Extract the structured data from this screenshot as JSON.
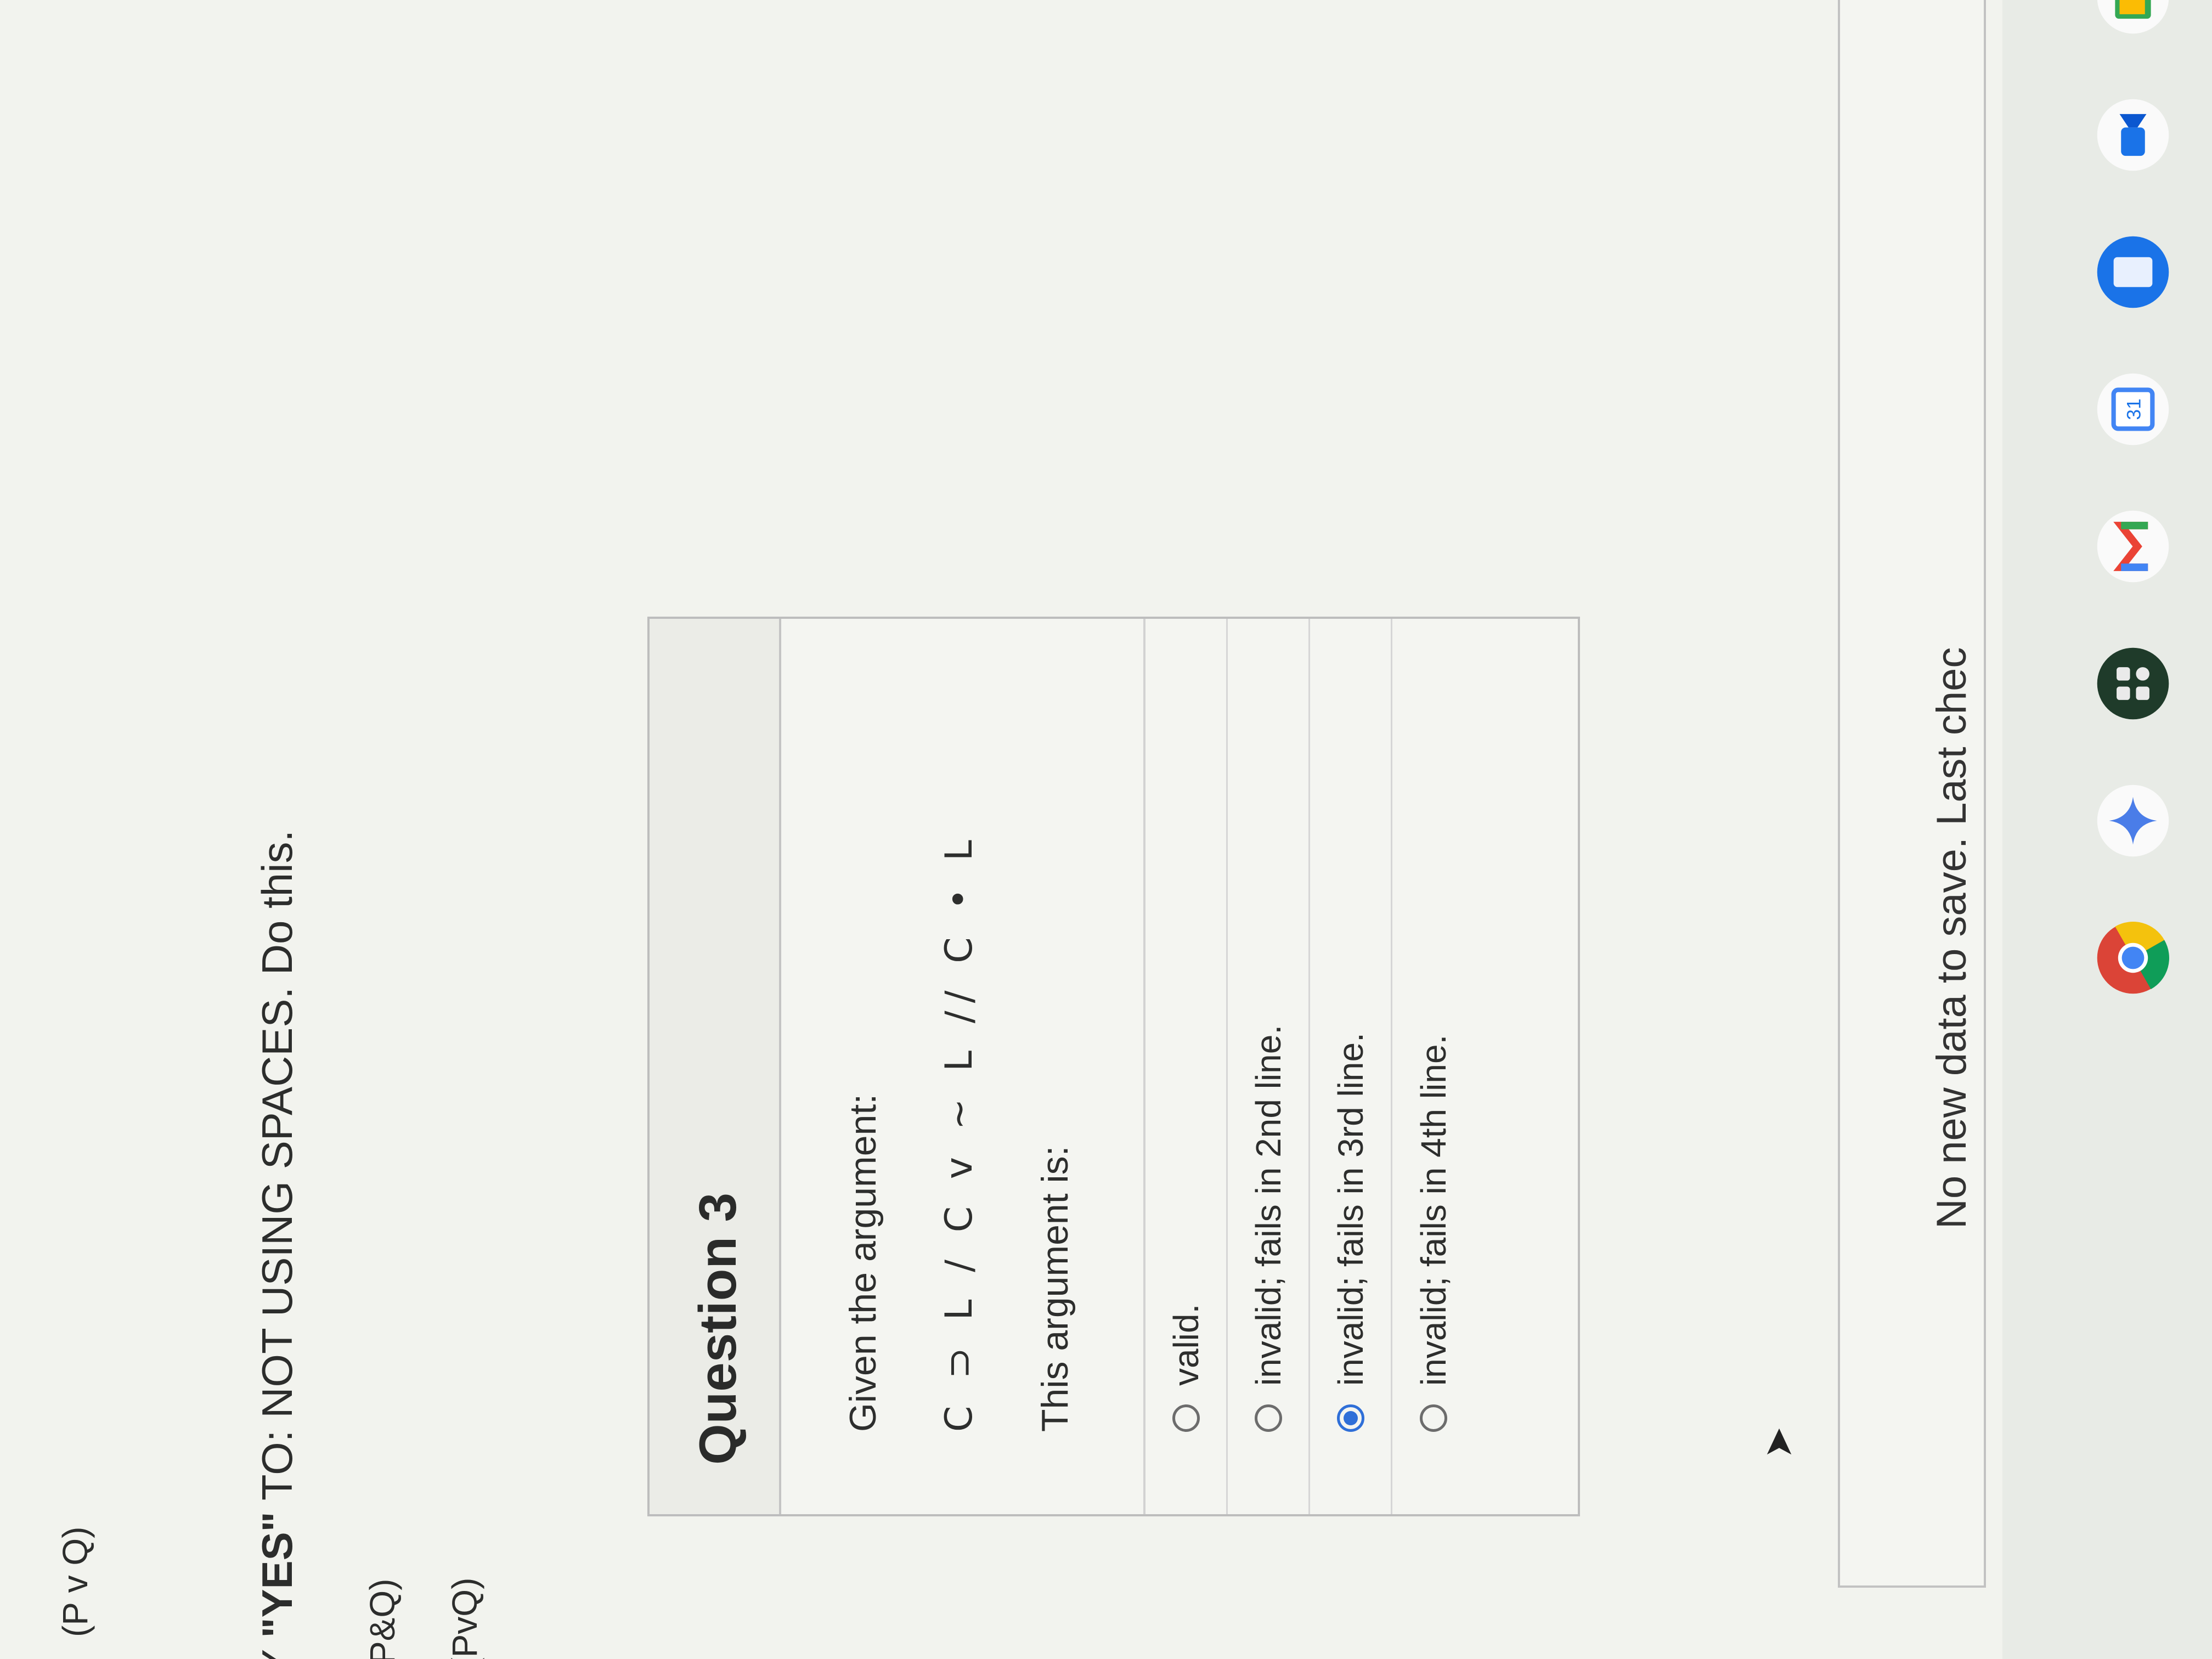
{
  "prior": {
    "formula": "(P v Q)",
    "instruction_prefix": "AY ",
    "instruction_strong": "\"YES\"",
    "instruction_suffix": " TO: NOT USING SPACES. Do this.",
    "line_a": "P&Q)",
    "line_b": "-(PvQ)"
  },
  "question": {
    "title": "Question 3",
    "prompt": "Given the argument:",
    "argument": "C ⊃ L / C v ~ L // C • L",
    "lead": "This argument is:",
    "options": [
      {
        "label": "valid.",
        "selected": false
      },
      {
        "label": "invalid; fails in 2nd line.",
        "selected": false
      },
      {
        "label": "invalid; fails in 3rd line.",
        "selected": true
      },
      {
        "label": "invalid; fails in 4th line.",
        "selected": false
      }
    ]
  },
  "footer": {
    "save_status": "No new data to save. Last chec"
  },
  "taskbar": {
    "apps": [
      "chrome-icon",
      "gemini-icon",
      "apps-grid-icon",
      "gmail-icon",
      "calendar-icon",
      "docs-icon",
      "meet-icon",
      "classroom-icon",
      "drive-icon"
    ],
    "calendar_day": "31"
  }
}
